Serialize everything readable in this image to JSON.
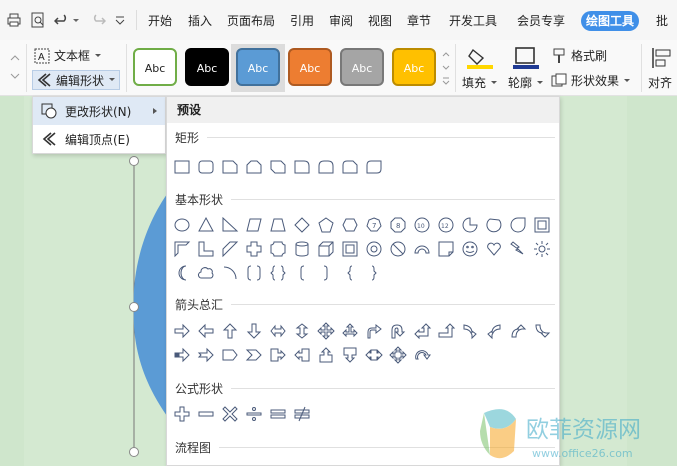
{
  "menu": {
    "items": [
      "开始",
      "插入",
      "页面布局",
      "引用",
      "审阅",
      "视图",
      "章节",
      "开发工具",
      "会员专享"
    ],
    "active_tab": "绘图工具",
    "cut_tab": "批"
  },
  "ribbon": {
    "textbox_label": "文本框",
    "edit_shape_label": "编辑形状",
    "style_samples": [
      {
        "label": "Abc",
        "bg": "#ffffff",
        "fg": "#222222",
        "border": "#70ad47"
      },
      {
        "label": "Abc",
        "bg": "#000000",
        "fg": "#ffffff",
        "border": "#000000"
      },
      {
        "label": "Abc",
        "bg": "#5b9bd5",
        "fg": "#ffffff",
        "border": "#41719c"
      },
      {
        "label": "Abc",
        "bg": "#ed7d31",
        "fg": "#ffffff",
        "border": "#ae5a21"
      },
      {
        "label": "Abc",
        "bg": "#a5a5a5",
        "fg": "#ffffff",
        "border": "#787878"
      },
      {
        "label": "Abc",
        "bg": "#ffc000",
        "fg": "#ffffff",
        "border": "#bc8c00"
      }
    ],
    "fill_label": "填充",
    "outline_label": "轮廓",
    "format_brush_label": "格式刷",
    "shape_effect_label": "形状效果",
    "align_label": "对齐"
  },
  "edit_dropdown": {
    "change_shape": "更改形状(N)",
    "edit_points": "编辑顶点(E)"
  },
  "shape_panel": {
    "header": "预设",
    "categories": {
      "rect": "矩形",
      "basic": "基本形状",
      "arrows": "箭头总汇",
      "formula": "公式形状",
      "flowchart": "流程图"
    }
  },
  "watermark": {
    "brand": "欧菲资源网",
    "url": "www.office26.com"
  },
  "colors": {
    "accent": "#3f8fe8",
    "shape_blue": "#5b9bd5",
    "shape_stroke": "#4a5a7a"
  }
}
